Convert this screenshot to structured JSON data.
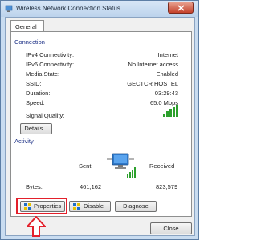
{
  "window": {
    "title": "Wireless Network Connection Status"
  },
  "tabs": [
    {
      "label": "General"
    }
  ],
  "connection": {
    "group_label": "Connection",
    "rows": [
      {
        "label": "IPv4 Connectivity:",
        "value": "Internet"
      },
      {
        "label": "IPv6 Connectivity:",
        "value": "No Internet access"
      },
      {
        "label": "Media State:",
        "value": "Enabled"
      },
      {
        "label": "SSID:",
        "value": "GECTCR HOSTEL"
      },
      {
        "label": "Duration:",
        "value": "03:29:43"
      },
      {
        "label": "Speed:",
        "value": "65.0 Mbps"
      }
    ],
    "signal_label": "Signal Quality:",
    "signal_bars": 5,
    "details_button": "Details..."
  },
  "activity": {
    "group_label": "Activity",
    "sent_label": "Sent",
    "received_label": "Received",
    "bytes_label": "Bytes:",
    "bytes_sent": "461,162",
    "bytes_received": "823,579"
  },
  "buttons": {
    "properties": "Properties",
    "disable": "Disable",
    "diagnose": "Diagnose",
    "close": "Close"
  },
  "colors": {
    "highlight": "#e3202b",
    "signal": "#2ca02c"
  }
}
